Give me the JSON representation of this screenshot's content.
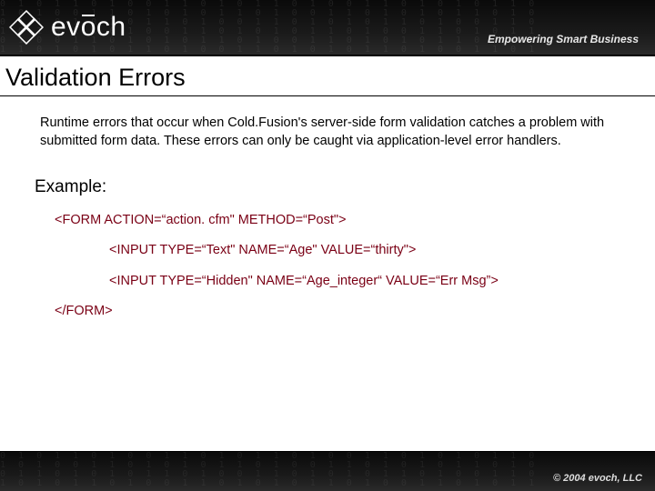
{
  "header": {
    "logo_text": "evōch",
    "tagline": "Empowering Smart Business"
  },
  "title": "Validation Errors",
  "description": "Runtime errors that occur when Cold.Fusion's server-side form validation catches a problem with submitted form data.  These errors can only be caught via application-level error handlers.",
  "example_label": "Example:",
  "code": {
    "line1": "<FORM ACTION=“action. cfm\" METHOD=“Post\">",
    "line2": "<INPUT TYPE=“Text\" NAME=“Age\" VALUE=“thirty\">",
    "line3": "<INPUT TYPE=“Hidden\" NAME=“Age_integer“ VALUE=“Err Msg”>",
    "line4": "</FORM>"
  },
  "footer": {
    "copyright": "© 2004 evoch, LLC"
  }
}
